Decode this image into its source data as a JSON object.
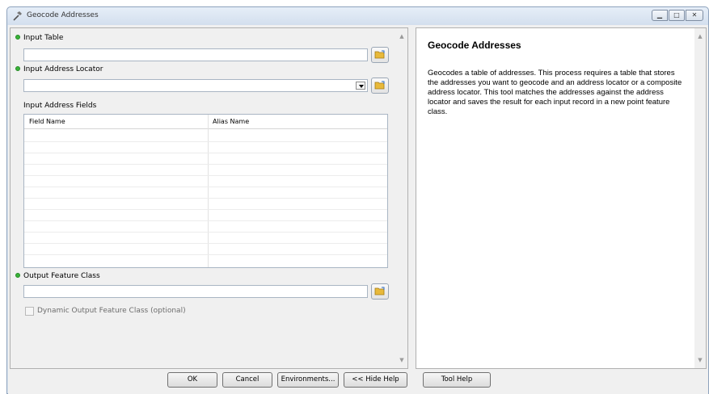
{
  "window": {
    "title": "Geocode Addresses"
  },
  "form": {
    "input_table_label": "Input Table",
    "input_table_value": "",
    "input_locator_label": "Input Address Locator",
    "input_locator_value": "",
    "fields_label": "Input Address Fields",
    "fields_columns": [
      "Field Name",
      "Alias Name"
    ],
    "output_label": "Output Feature Class",
    "output_value": "",
    "dynamic_label": "Dynamic Output Feature Class (optional)",
    "dynamic_checked": false
  },
  "help": {
    "title": "Geocode Addresses",
    "body": "Geocodes a table of addresses. This process requires a table that stores the addresses you want to geocode and an address locator or a composite address locator. This tool matches the addresses against the address locator and saves the result for each input record in a new point feature class."
  },
  "buttons": {
    "ok": "OK",
    "cancel": "Cancel",
    "environments": "Environments...",
    "hide_help": "<< Hide Help",
    "tool_help": "Tool Help"
  },
  "icons": {
    "title": "hammer-icon",
    "browse": "open-folder-icon",
    "required": "required-dot-icon"
  },
  "colors": {
    "required_dot": "#3ab33a",
    "folder": "#e8b93a"
  }
}
